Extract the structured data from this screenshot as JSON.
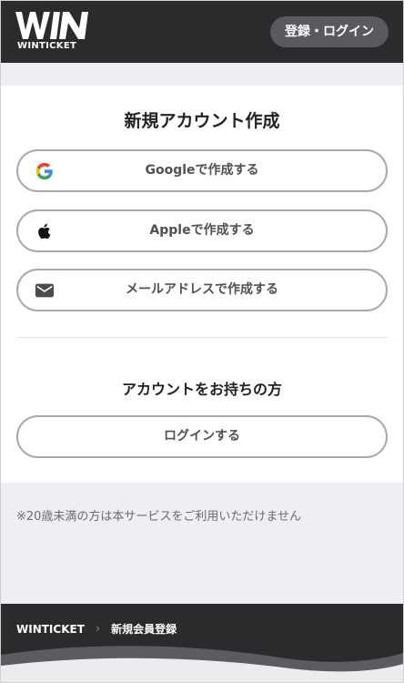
{
  "header": {
    "logo_text": "WIN",
    "logo_subtext": "WINTICKET",
    "login_button": "登録・ログイン"
  },
  "signup": {
    "title": "新規アカウント作成",
    "google_button": "Googleで作成する",
    "apple_button": "Appleで作成する",
    "email_button": "メールアドレスで作成する"
  },
  "existing": {
    "title": "アカウントをお持ちの方",
    "login_button": "ログインする"
  },
  "notice": "※20歳未満の方は本サービスをご利用いただけません",
  "breadcrumb": {
    "items": [
      "WINTICKET",
      "新規会員登録"
    ]
  },
  "icons": {
    "google": "google-icon",
    "apple": "apple-icon",
    "mail": "mail-icon",
    "separator": "chevron-right-icon"
  },
  "colors": {
    "header_bg": "#2b2b2e",
    "pill_bg": "#5a5a5e",
    "button_border": "#a9a9ad",
    "page_bg": "#efeff3"
  }
}
